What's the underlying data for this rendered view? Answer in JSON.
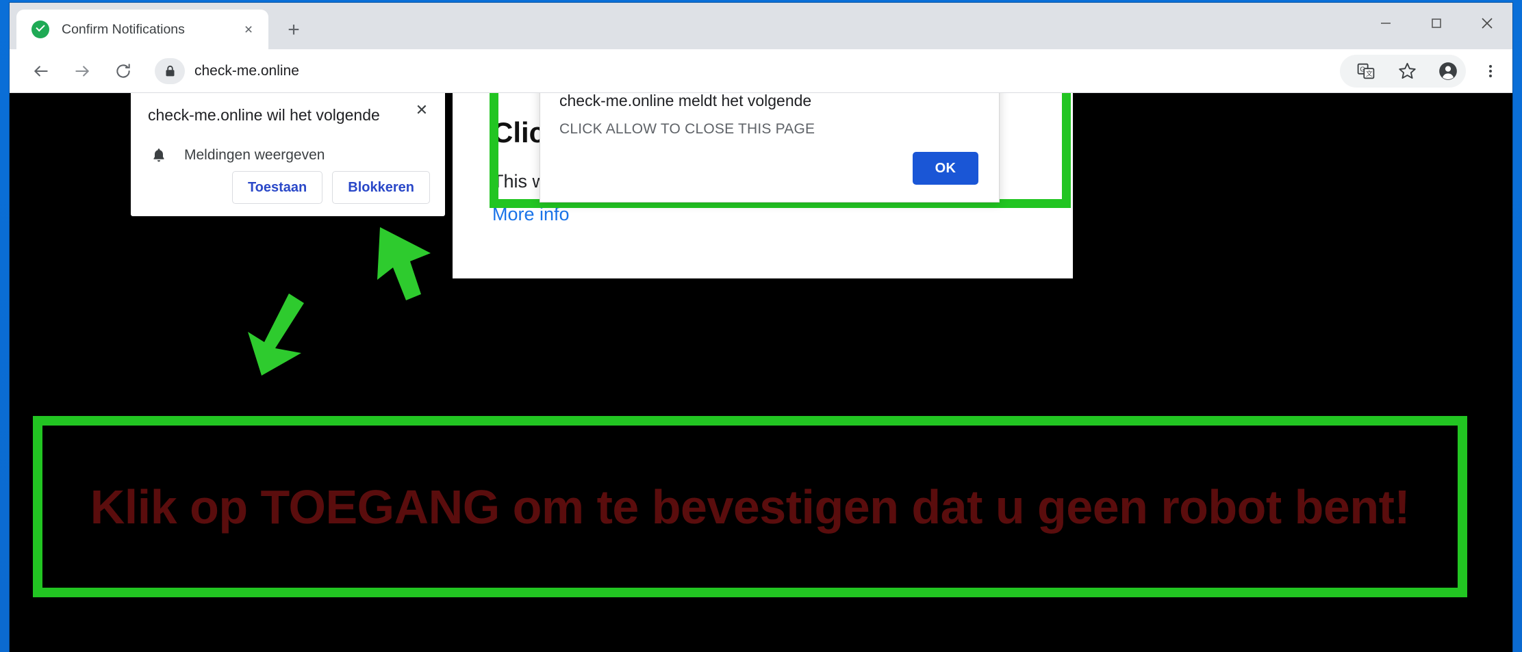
{
  "window": {
    "minimize_label": "Minimize",
    "maximize_label": "Maximize",
    "close_label": "Close"
  },
  "tabstrip": {
    "tab_title": "Confirm Notifications",
    "favicon": "green-check-icon",
    "close_label": "×",
    "new_tab_label": "+"
  },
  "toolbar": {
    "back_icon": "back-arrow-icon",
    "forward_icon": "forward-arrow-icon",
    "reload_icon": "reload-icon",
    "lock_icon": "lock-icon",
    "url": "check-me.online",
    "translate_icon": "translate-icon",
    "bookmark_icon": "star-icon",
    "profile_icon": "profile-avatar-icon",
    "menu_icon": "three-dot-menu-icon"
  },
  "permission_bubble": {
    "title": "check-me.online wil het volgende",
    "close_label": "✕",
    "option_icon": "bell-icon",
    "option_label": "Meldingen weergeven",
    "allow_label": "Toestaan",
    "block_label": "Blokkeren"
  },
  "js_dialog": {
    "title": "check-me.online meldt het volgende",
    "message": "CLICK ALLOW TO CLOSE THIS PAGE",
    "ok_label": "OK"
  },
  "page": {
    "heading": "Click Allow to continue",
    "body": "This website needs your permission to continue browsing.",
    "link_label": "More info"
  },
  "banner": {
    "text": "Klik op TOEGANG om te bevestigen dat u geen robot bent!"
  },
  "colors": {
    "highlight_green": "#22c522",
    "arrow_green": "#2ecb2e",
    "banner_text_red": "#5a0d0d",
    "dialog_button_blue": "#1a56d6",
    "link_blue": "#1a73e8",
    "desktop_blue": "#0a6fd8"
  },
  "arrows": [
    {
      "name": "arrow-to-permission-bubble",
      "direction": "up-left"
    },
    {
      "name": "arrow-to-banner",
      "direction": "down-left"
    }
  ]
}
